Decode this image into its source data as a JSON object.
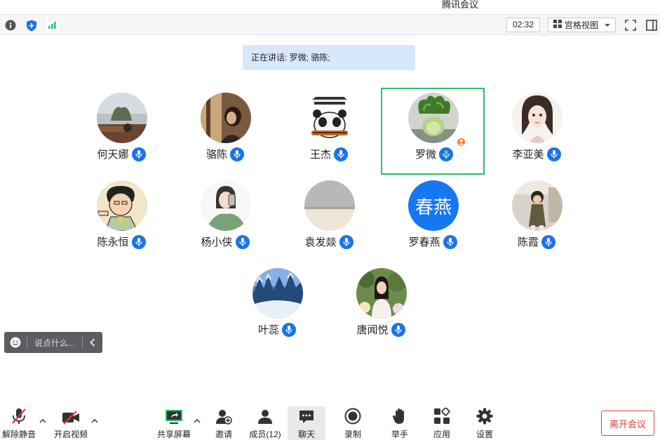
{
  "window": {
    "title": "腾讯会议"
  },
  "topbar": {
    "timer": "02:32",
    "view_label": "宫格视图",
    "icons": [
      "info-icon",
      "shield-icon",
      "signal-icon",
      "grid-view-icon",
      "fullscreen-icon",
      "sidebar-toggle-icon"
    ]
  },
  "speaking": {
    "label": "正在讲话: 罗微; 骆陈;"
  },
  "participants": [
    {
      "name": "何天娜",
      "avatar": "photo-outdoor"
    },
    {
      "name": "骆陈",
      "avatar": "photo-girl-window"
    },
    {
      "name": "王杰",
      "avatar": "panda-guitar"
    },
    {
      "name": "罗微",
      "avatar": "photo-vegetable",
      "active": true,
      "host": true
    },
    {
      "name": "李亚美",
      "avatar": "anime-girl"
    },
    {
      "name": "陈永恒",
      "avatar": "cartoon-man"
    },
    {
      "name": "杨小侠",
      "avatar": "sketch-girl"
    },
    {
      "name": "袁发燚",
      "avatar": "wall-gray"
    },
    {
      "name": "罗春燕",
      "avatar": "text",
      "avatar_text": "春燕"
    },
    {
      "name": "陈霞",
      "avatar": "photo-child-mall"
    },
    {
      "name": "叶蕊",
      "avatar": "snow-trees"
    },
    {
      "name": "唐闻悦",
      "avatar": "girl-flowers"
    }
  ],
  "chat": {
    "placeholder": "说点什么..."
  },
  "toolbar": {
    "unmute": "解除静音",
    "start_video": "开启视频",
    "share_screen": "共享屏幕",
    "invite": "邀请",
    "members": "成员(12)",
    "chat": "聊天",
    "record": "录制",
    "raise_hand": "举手",
    "apps": "应用",
    "settings": "设置",
    "leave": "离开会议"
  },
  "colors": {
    "accent": "#1a73e8",
    "active_border": "#2ebd6b",
    "leave": "#e23c3c",
    "banner": "#d7e8fb"
  }
}
